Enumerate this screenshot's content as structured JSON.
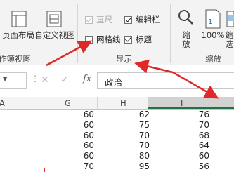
{
  "ribbon": {
    "workbook_views": {
      "page_layout_label": "页面布局",
      "custom_views_label": "自定义视图",
      "group_label": "作簿视图"
    },
    "show": {
      "ruler_label": "直尺",
      "ruler_checked": true,
      "ruler_enabled": false,
      "formula_bar_label": "编辑栏",
      "formula_bar_checked": true,
      "gridlines_label": "网格线",
      "gridlines_checked": false,
      "headings_label": "标题",
      "headings_checked": true,
      "group_label": "显示"
    },
    "zoom": {
      "zoom_label_1": "缩",
      "zoom_label_2": "放",
      "zoom100_label": "100%",
      "zoom_selection_1": "缩",
      "zoom_selection_2": "选",
      "group_label": "缩放"
    }
  },
  "formula_bar": {
    "cancel_icon": "x-icon",
    "enter_icon": "check-icon",
    "fx_label": "fx",
    "value": "政治"
  },
  "grid": {
    "columns": [
      "A",
      "G",
      "H",
      "I"
    ],
    "selected_column": "I",
    "rows": [
      [
        "60",
        "62",
        "76"
      ],
      [
        "60",
        "75",
        "70"
      ],
      [
        "60",
        "70",
        "68"
      ],
      [
        "60",
        "70",
        "64"
      ],
      [
        "60",
        "80",
        "60"
      ],
      [
        "70",
        "95",
        "56"
      ]
    ]
  },
  "colors": {
    "accent_green": "#217346",
    "arrow_red": "#e02828"
  }
}
